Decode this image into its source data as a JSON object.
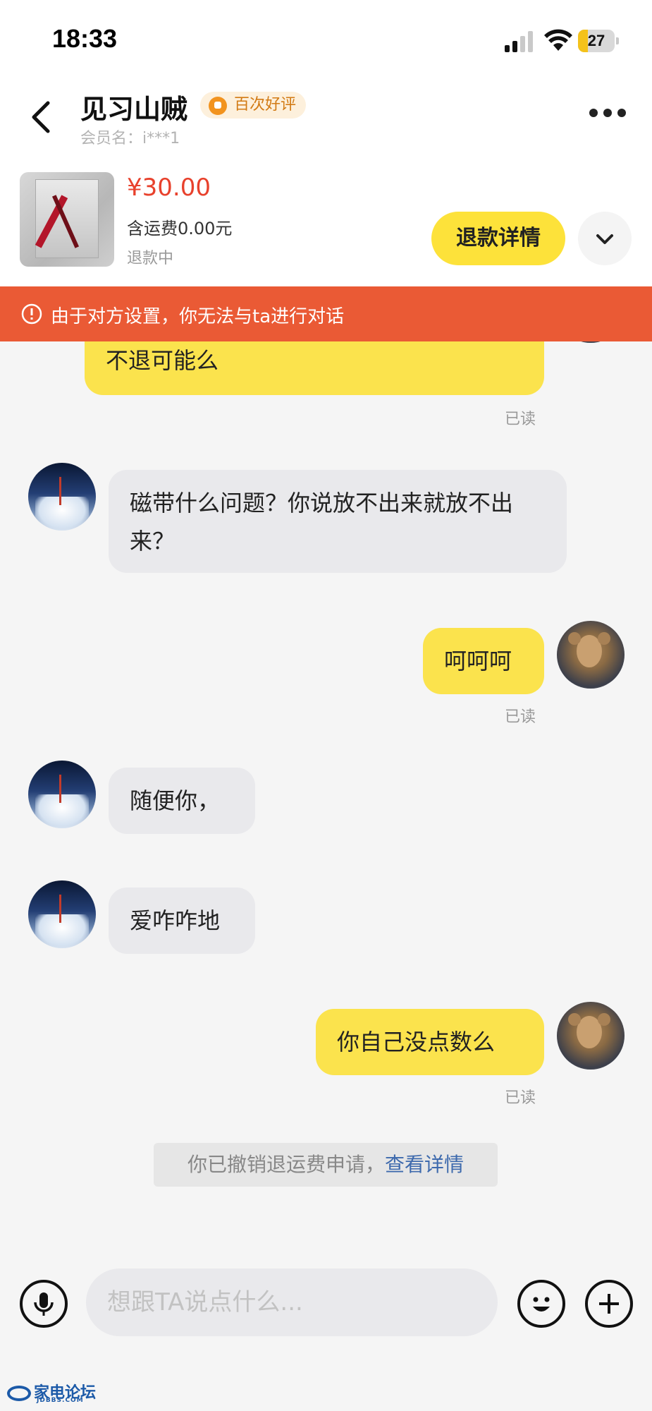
{
  "status_bar": {
    "time": "18:33",
    "battery": "27",
    "battery_level": 0.27,
    "accent": "#f4c21b"
  },
  "header": {
    "seller_name": "见习山贼",
    "badge": "百次好评",
    "member_name": "会员名：i***1",
    "back_icon": "chevron-left-icon",
    "more_icon": "more-dots-icon"
  },
  "order": {
    "price": "¥30.00",
    "shipping": "含运费0.00元",
    "status": "退款中",
    "refund_button": "退款详情",
    "expand_icon": "chevron-down-icon"
  },
  "banner": {
    "text": "由于对方设置，你无法与ta进行对话",
    "color": "#ea5a35",
    "icon": "exclamation-circle-icon"
  },
  "messages": [
    {
      "sender": "me",
      "text": "不退可能么",
      "read": "已读"
    },
    {
      "sender": "them",
      "text": "磁带什么问题？你说放不出来就放不出来？"
    },
    {
      "sender": "me",
      "text": "呵呵呵",
      "read": "已读"
    },
    {
      "sender": "them",
      "text": "随便你，"
    },
    {
      "sender": "them",
      "text": "爱咋咋地"
    },
    {
      "sender": "me",
      "text": "你自己没点数么",
      "read": "已读"
    }
  ],
  "system_notice": {
    "text": "你已撤销退运费申请，",
    "link": "查看详情"
  },
  "input_bar": {
    "placeholder": "想跟TA说点什么...",
    "voice_icon": "microphone-icon",
    "emoji_icon": "emoji-icon",
    "plus_icon": "plus-icon"
  },
  "watermark": {
    "name": "家电论坛",
    "sub": "JDBBS.COM"
  },
  "colors": {
    "my_bubble": "#fbe34d",
    "their_bubble": "#e9e9ec",
    "price": "#e8412c",
    "refund_button": "#fde23a"
  }
}
